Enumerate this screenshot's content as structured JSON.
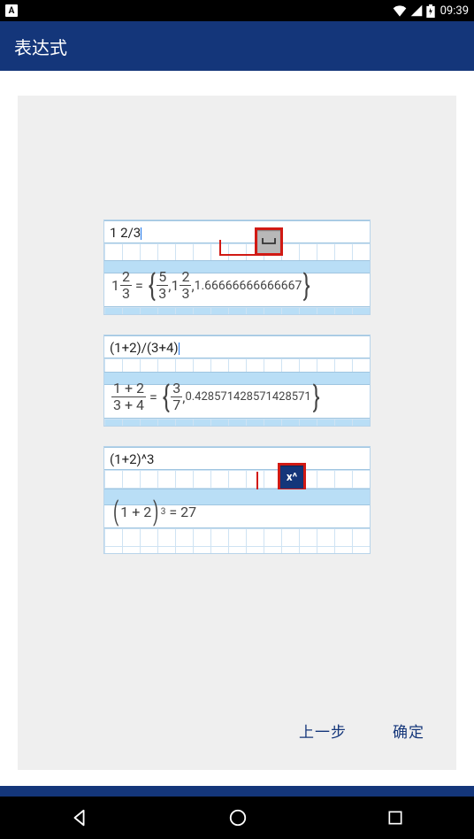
{
  "status": {
    "app_indicator": "A",
    "time": "09:39"
  },
  "appbar": {
    "title": "表达式"
  },
  "examples": {
    "ex1": {
      "input": "1 2/3",
      "key_label": "␣",
      "result": {
        "whole": "1",
        "frac1_num": "2",
        "frac1_den": "3",
        "eq": "=",
        "s1_num": "5",
        "s1_den": "3",
        "s2_whole": "1",
        "s2_num": "2",
        "s2_den": "3",
        "decimal": "1.66666666666667"
      }
    },
    "ex2": {
      "input": "(1+2)/(3+4)",
      "result": {
        "f1_num": "1 + 2",
        "f1_den": "3 + 4",
        "eq": "=",
        "s1_num": "3",
        "s1_den": "7",
        "decimal": "0.428571428571428571"
      }
    },
    "ex3": {
      "input": "(1+2)^3",
      "key_label": "x^",
      "result": {
        "base": "1 + 2",
        "exp": "3",
        "eq": "=",
        "value": "27"
      }
    }
  },
  "footer": {
    "prev": "上一步",
    "ok": "确定"
  }
}
